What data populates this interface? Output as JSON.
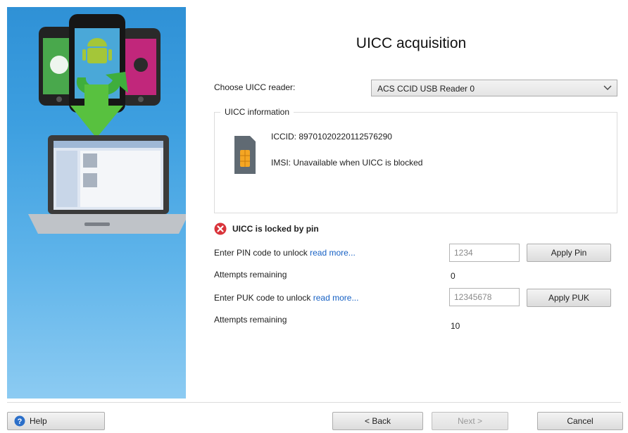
{
  "title": "UICC acquisition",
  "reader": {
    "label": "Choose UICC reader:",
    "selected": "ACS CCID USB Reader 0"
  },
  "uicc_info": {
    "legend": "UICC information",
    "iccid": "ICCID: 89701020220112576290",
    "imsi": "IMSI: Unavailable when UICC is blocked"
  },
  "lock": {
    "status": "UICC is locked by pin",
    "pin_label": "Enter PIN code to unlock",
    "read_more": "read more...",
    "pin_value": "1234",
    "apply_pin": "Apply Pin",
    "pin_attempts_label": "Attempts remaining",
    "pin_attempts": "0",
    "puk_label": "Enter PUK code to unlock",
    "puk_value": "12345678",
    "apply_puk": "Apply PUK",
    "puk_attempts_label": "Attempts remaining",
    "puk_attempts": "10"
  },
  "footer": {
    "help": "Help",
    "back": "< Back",
    "next": "Next >",
    "cancel": "Cancel"
  },
  "colors": {
    "side_panel": "#3d9fe0",
    "link": "#1560c4",
    "error": "#d9343b"
  },
  "icons": {
    "reader_dropdown": "chevron-down-icon",
    "sim": "sim-card-icon",
    "status": "error-x-icon",
    "help": "question-circle-icon"
  }
}
